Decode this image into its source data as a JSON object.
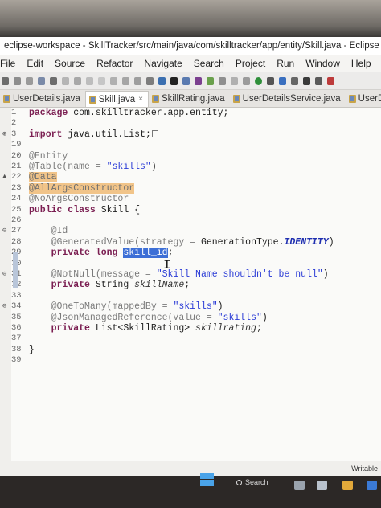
{
  "window": {
    "title": "eclipse-workspace - SkillTracker/src/main/java/com/skilltracker/app/entity/Skill.java - Eclipse IDE"
  },
  "menu": [
    "File",
    "Edit",
    "Source",
    "Refactor",
    "Navigate",
    "Search",
    "Project",
    "Run",
    "Window",
    "Help"
  ],
  "tabs": [
    {
      "label": "UserDetails.java",
      "active": false
    },
    {
      "label": "Skill.java",
      "active": true,
      "close": "×"
    },
    {
      "label": "SkillRating.java",
      "active": false
    },
    {
      "label": "UserDetailsService.java",
      "active": false
    },
    {
      "label": "UserDetailsC",
      "active": false
    }
  ],
  "editor": {
    "lines": [
      {
        "n": "1",
        "kw": "package",
        "rest": " com.skilltracker.app.entity;"
      },
      {
        "n": "2"
      },
      {
        "n": "3",
        "marker": "⊕",
        "kw": "import",
        "rest": " java.util.List;"
      },
      {
        "n": "19"
      },
      {
        "n": "20",
        "ann": "@Entity"
      },
      {
        "n": "21",
        "ann": "@Table(name = ",
        "str": "\"skills\"",
        "tail": ")"
      },
      {
        "n": "22",
        "marker": "▲",
        "hl": "@Data"
      },
      {
        "n": "23",
        "hl": "@AllArgsConstructor"
      },
      {
        "n": "24",
        "ann": "@NoArgsConstructor"
      },
      {
        "n": "25",
        "kw": "public class",
        "rest": " Skill {"
      },
      {
        "n": "26"
      },
      {
        "n": "27",
        "marker": "⊖",
        "indent": "    ",
        "ann": "@Id"
      },
      {
        "n": "28",
        "indent": "    ",
        "ann": "@GeneratedValue(strategy = ",
        "rest": "GenerationType.",
        "cst": "IDENTITY",
        "tail": ")"
      },
      {
        "n": "29",
        "indent": "    ",
        "kw": "private long",
        "rest": " ",
        "sel": "skill_id",
        "tail": ";"
      },
      {
        "n": "30"
      },
      {
        "n": "31",
        "marker": "⊖",
        "indent": "    ",
        "ann": "@NotNull(message = ",
        "str": "\"Skill Name shouldn't be null\"",
        "tail": ")"
      },
      {
        "n": "32",
        "indent": "    ",
        "kw": "private",
        "rest": " String ",
        "ital": "skillName",
        "tail": ";"
      },
      {
        "n": "33"
      },
      {
        "n": "34",
        "marker": "⊖",
        "indent": "    ",
        "ann": "@OneToMany(mappedBy = ",
        "str": "\"skills\"",
        "tail": ")"
      },
      {
        "n": "35",
        "indent": "    ",
        "ann": "@JsonManagedReference(value = ",
        "str": "\"skills\"",
        "tail": ")"
      },
      {
        "n": "36",
        "indent": "    ",
        "kw": "private",
        "rest": " List<SkillRating> ",
        "ital": "skillrating",
        "tail": ";"
      },
      {
        "n": "37"
      },
      {
        "n": "38",
        "rest": "}"
      },
      {
        "n": "39"
      }
    ]
  },
  "status": {
    "writable": "Writable"
  },
  "taskbar": {
    "search_label": "Search"
  },
  "colors": {
    "selection": "#3d6fd6",
    "annotation_highlight": "#f1c489",
    "keyword": "#7b1f52",
    "string": "#2a3bd6"
  }
}
